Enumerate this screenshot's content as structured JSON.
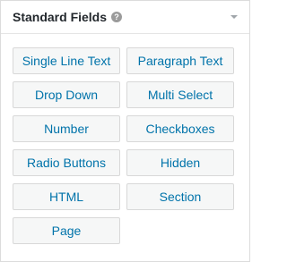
{
  "panel": {
    "title": "Standard Fields",
    "help_icon_glyph": "?",
    "help_icon": "question-circle-icon",
    "toggle_icon": "caret-down-icon"
  },
  "fields": [
    "Single Line Text",
    "Paragraph Text",
    "Drop Down",
    "Multi Select",
    "Number",
    "Checkboxes",
    "Radio Buttons",
    "Hidden",
    "HTML",
    "Section",
    "Page"
  ],
  "colors": {
    "button_text": "#0073aa",
    "button_bg": "#f6f7f7",
    "title_text": "#23282d"
  }
}
